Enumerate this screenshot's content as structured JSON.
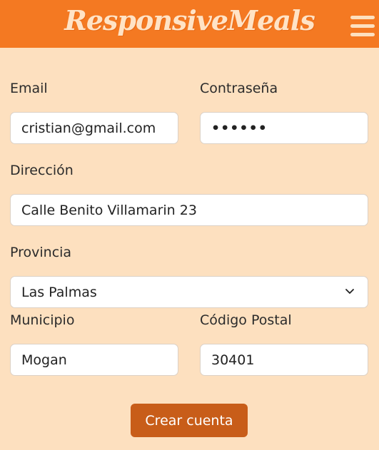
{
  "header": {
    "logo": "ResponsiveMeals",
    "menu_icon": "hamburger-menu-icon"
  },
  "form": {
    "email_label": "Email",
    "email_value": "cristian@gmail.com",
    "password_label": "Contraseña",
    "password_value": "••••••",
    "address_label": "Dirección",
    "address_value": "Calle Benito Villamarin 23",
    "province_label": "Provincia",
    "province_value": "Las Palmas",
    "municipality_label": "Municipio",
    "municipality_value": "Mogan",
    "postal_label": "Código Postal",
    "postal_value": "30401",
    "submit_label": "Crear cuenta"
  },
  "colors": {
    "header_bg": "#f47922",
    "page_bg": "#fde0bf",
    "button_bg": "#c85d19"
  }
}
